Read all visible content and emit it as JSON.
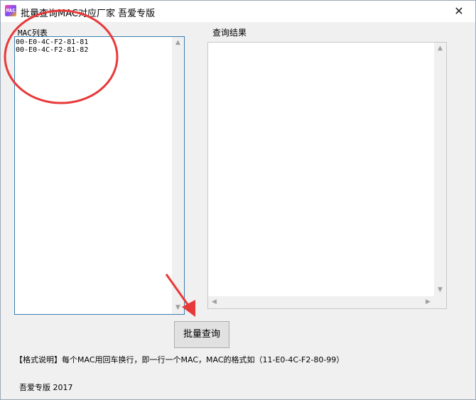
{
  "window": {
    "title": "批量查询MAC对应厂家 吾爱专版",
    "app_icon_text": "MAC",
    "close_glyph": "✕"
  },
  "mac_panel": {
    "label": "MAC列表",
    "lines": [
      "00-E0-4C-F2-81-81",
      "00-E0-4C-F2-81-82"
    ]
  },
  "result_panel": {
    "label": "查询结果"
  },
  "scroll": {
    "up": "▲",
    "down": "▼",
    "left": "◀",
    "right": "▶"
  },
  "query_button": {
    "label": "批量查询"
  },
  "format_note": "【格式说明】每个MAC用回车换行，即一行一个MAC，MAC的格式如（11-E0-4C-F2-80-99）",
  "footer": "吾爱专版 2017",
  "colors": {
    "annotation": "#e8393a",
    "textbox_focus_border": "#3c7fb1"
  }
}
